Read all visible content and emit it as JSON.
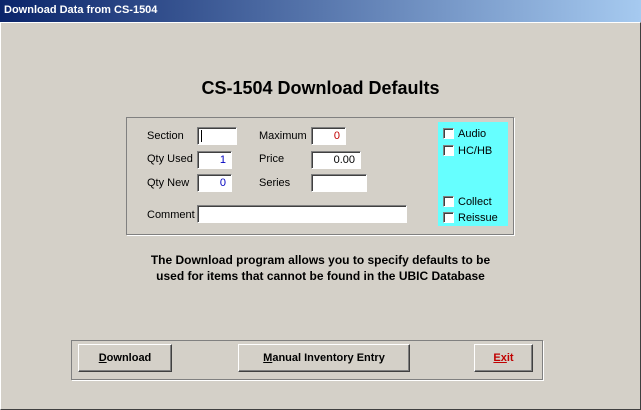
{
  "window": {
    "title": "Download Data from CS-1504"
  },
  "heading": "CS-1504 Download Defaults",
  "form": {
    "section_label": "Section",
    "section_value": "",
    "qty_used_label": "Qty Used",
    "qty_used_value": "1",
    "qty_new_label": "Qty New",
    "qty_new_value": "0",
    "maximum_label": "Maximum",
    "maximum_value": "0",
    "price_label": "Price",
    "price_value": "0.00",
    "series_label": "Series",
    "series_value": "",
    "comment_label": "Comment",
    "comment_value": ""
  },
  "options": {
    "audio_label": "Audio",
    "hchb_label": "HC/HB",
    "collect_label": "Collect",
    "reissue_label": "Reissue"
  },
  "description": {
    "line1": "The Download program allows you to specify defaults to be",
    "line2": "used for items that cannot be found in the UBIC Database"
  },
  "buttons": {
    "download_mnemonic": "D",
    "download_rest": "ownload",
    "manual_mnemonic": "M",
    "manual_rest": "anual Inventory Entry",
    "exit_mnemonic": "Ex",
    "exit_rest": "it"
  },
  "colors": {
    "cyan_panel": "#66ffff",
    "accent_blue": "#0000c0",
    "accent_red": "#c00000"
  }
}
